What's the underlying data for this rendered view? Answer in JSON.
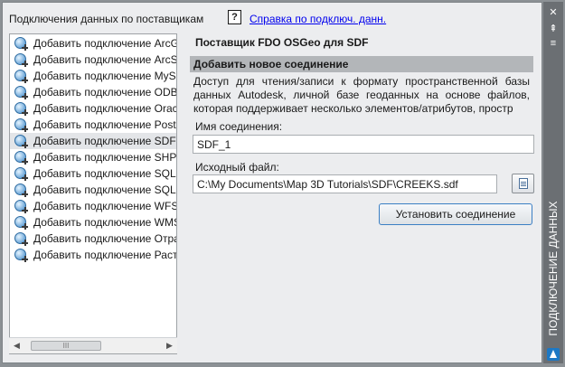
{
  "panel": {
    "header_title": "Подключения данных по поставщикам",
    "help_link": "Справка по подключ. данн."
  },
  "providers": [
    {
      "label": "Добавить подключение ArcG",
      "icon": "globe-add-icon"
    },
    {
      "label": "Добавить подключение ArcS",
      "icon": "globe-add-icon"
    },
    {
      "label": "Добавить подключение MyS",
      "icon": "globe-add-icon"
    },
    {
      "label": "Добавить подключение ODB",
      "icon": "globe-add-icon"
    },
    {
      "label": "Добавить подключение Orac",
      "icon": "globe-add-icon"
    },
    {
      "label": "Добавить подключение Post",
      "icon": "globe-add-icon"
    },
    {
      "label": "Добавить подключение SDF",
      "icon": "globe-add-icon",
      "selected": true
    },
    {
      "label": "Добавить подключение SHP",
      "icon": "globe-add-icon"
    },
    {
      "label": "Добавить подключение SQL",
      "icon": "globe-add-icon"
    },
    {
      "label": "Добавить подключение SQLi",
      "icon": "globe-add-icon"
    },
    {
      "label": "Добавить подключение WFS",
      "icon": "globe-add-icon"
    },
    {
      "label": "Добавить подключение WMS",
      "icon": "globe-add-icon"
    },
    {
      "label": "Добавить подключение Отра",
      "icon": "globe-add-icon"
    },
    {
      "label": "Добавить подключение Раст",
      "icon": "globe-add-icon"
    }
  ],
  "scrollbar": {
    "thumb_grip": "III"
  },
  "detail": {
    "provider_title": "Поставщик FDO OSGeo для SDF",
    "section_title": "Добавить новое соединение",
    "description": "Доступ для чтения/записи к формату пространственной базы данных Autodesk, личной базе геоданных на основе файлов, которая поддерживает несколько элементов/атрибутов, простр",
    "connection_name_label": "Имя соединения:",
    "connection_name_value": "SDF_1",
    "source_file_label": "Исходный файл:",
    "source_file_value": "C:\\My Documents\\Map 3D Tutorials\\SDF\\CREEKS.sdf",
    "connect_button": "Установить соединение"
  },
  "sidebar": {
    "title": "ПОДКЛЮЧЕНИЕ ДАННЫХ"
  }
}
